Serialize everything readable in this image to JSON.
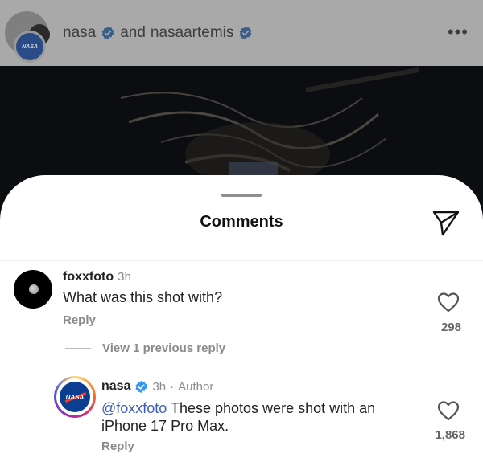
{
  "post": {
    "account": "nasa",
    "connector": "and",
    "collaborator": "nasaartemis",
    "more_icon": "more-horizontal-icon",
    "avatar_text": "NASA"
  },
  "sheet": {
    "title": "Comments",
    "share_icon": "paper-plane-icon"
  },
  "comments": [
    {
      "username": "foxxfoto",
      "time": "3h",
      "text": "What was this shot with?",
      "reply_label": "Reply",
      "likes": "298",
      "view_replies": "View 1 previous reply"
    },
    {
      "username": "nasa",
      "time": "3h",
      "separator": "·",
      "author_badge": "Author",
      "mention": "@foxxfoto",
      "text": " These photos were shot with an iPhone 17 Pro Max.",
      "reply_label": "Reply",
      "likes": "1,868",
      "avatar_text": "NASA"
    }
  ],
  "colors": {
    "verified": "#3797f0",
    "mention": "#3b5db5",
    "muted": "#8a8a8a"
  }
}
